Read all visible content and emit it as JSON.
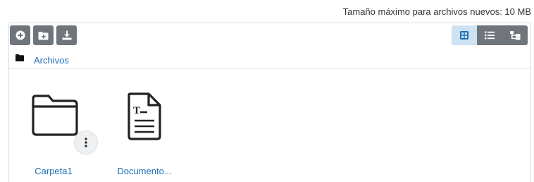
{
  "upload": {
    "max_size_text": "Tamaño máximo para archivos nuevos: 10 MB"
  },
  "toolbar": {
    "buttons": [
      {
        "icon": "add-file-icon"
      },
      {
        "icon": "create-folder-icon"
      },
      {
        "icon": "download-icon"
      }
    ],
    "views": [
      {
        "icon": "grid-view-icon",
        "active": true
      },
      {
        "icon": "list-view-icon",
        "active": false
      },
      {
        "icon": "tree-view-icon",
        "active": false
      }
    ]
  },
  "path": {
    "crumb": "Archivos"
  },
  "files": [
    {
      "name": "Carpeta1",
      "type": "folder"
    },
    {
      "name": "Documento...",
      "type": "text-document"
    }
  ],
  "colors": {
    "button_bg": "#6f757b",
    "active_view_bg": "#cfe2f3",
    "link": "#1f6fb3"
  }
}
